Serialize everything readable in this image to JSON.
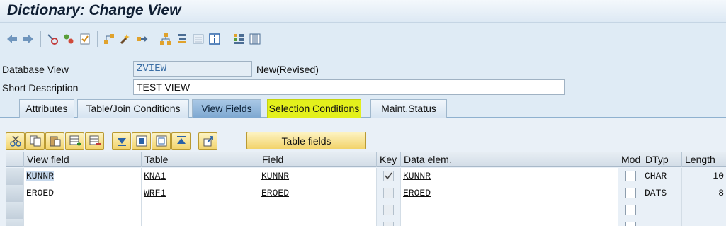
{
  "title": "Dictionary: Change View",
  "toolbar": {
    "buttons": [
      {
        "icon": "back-arrow-icon"
      },
      {
        "icon": "forward-arrow-icon"
      },
      {
        "icon": "other-object-icon"
      },
      {
        "icon": "display-change-icon"
      },
      {
        "icon": "check-icon"
      },
      {
        "icon": "activate-icon"
      },
      {
        "icon": "where-used-icon"
      },
      {
        "icon": "object-list-icon"
      },
      {
        "icon": "hierarchy-icon"
      },
      {
        "icon": "navigate-icon"
      },
      {
        "icon": "contents-icon"
      },
      {
        "icon": "info-icon"
      },
      {
        "icon": "layout-icon"
      },
      {
        "icon": "columns-icon"
      }
    ]
  },
  "form": {
    "database_view_label": "Database View",
    "database_view_value": "ZVIEW",
    "database_view_status": "New(Revised)",
    "short_description_label": "Short Description",
    "short_description_value": "TEST VIEW"
  },
  "tabs": [
    {
      "label": "Attributes"
    },
    {
      "label": "Table/Join Conditions"
    },
    {
      "label": "View Fields"
    },
    {
      "label": "Selection Conditions"
    },
    {
      "label": "Maint.Status"
    }
  ],
  "active_tab": "View Fields",
  "highlighted_tab": "Selection Conditions",
  "table_fields_button": "Table fields",
  "grid": {
    "columns": [
      "View field",
      "Table",
      "Field",
      "Key",
      "Data elem.",
      "Mod",
      "DTyp",
      "Length"
    ],
    "rows": [
      {
        "view_field": "KUNNR",
        "table": "KNA1",
        "field": "KUNNR",
        "key": true,
        "data_elem": "KUNNR",
        "mod": false,
        "dtyp": "CHAR",
        "length": "10"
      },
      {
        "view_field": "EROED",
        "table": "WRF1",
        "field": "EROED",
        "key": false,
        "data_elem": "EROED",
        "mod": false,
        "dtyp": "DATS",
        "length": "8"
      },
      {
        "view_field": "",
        "table": "",
        "field": "",
        "key": false,
        "data_elem": "",
        "mod": false,
        "dtyp": "",
        "length": ""
      },
      {
        "view_field": "",
        "table": "",
        "field": "",
        "key": false,
        "data_elem": "",
        "mod": false,
        "dtyp": "",
        "length": ""
      }
    ]
  },
  "colors": {
    "highlight": "#e3f01c",
    "active_tab": "#7ea8d1",
    "background": "#dfebf5"
  }
}
